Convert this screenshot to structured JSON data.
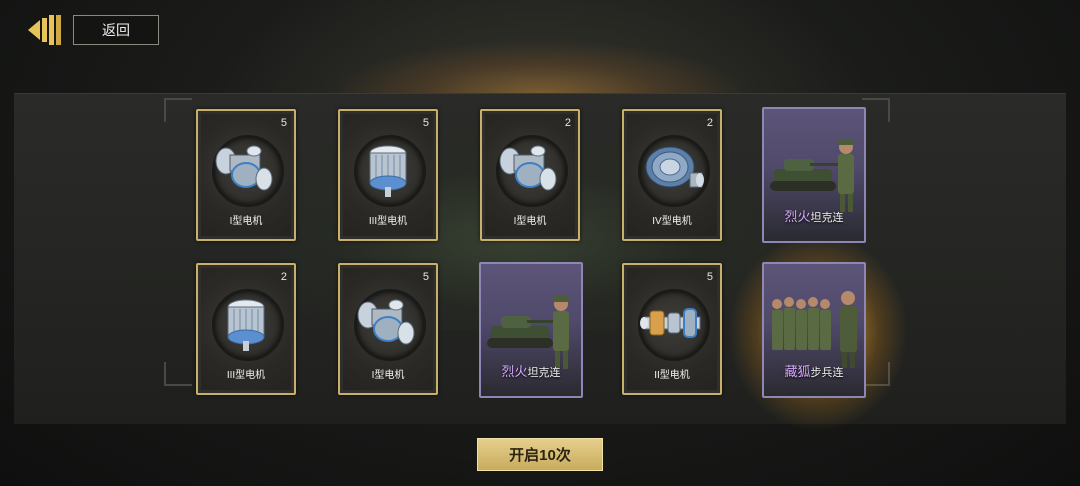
{
  "header": {
    "back_label": "返回"
  },
  "rewards": [
    {
      "name": "I型电机",
      "count": "5",
      "icon": "motor-part-icon"
    },
    {
      "name": "III型电机",
      "count": "5",
      "icon": "motor-cylinder-icon"
    },
    {
      "name": "I型电机",
      "count": "2",
      "icon": "motor-part-icon"
    },
    {
      "name": "IV型电机",
      "count": "2",
      "icon": "gear-motor-icon"
    },
    {
      "name_highlight": "烈火",
      "name_suffix": "坦克连",
      "icon": "tank-unit-icon"
    },
    {
      "name": "III型电机",
      "count": "2",
      "icon": "motor-cylinder-icon"
    },
    {
      "name": "I型电机",
      "count": "5",
      "icon": "motor-part-icon"
    },
    {
      "name_highlight": "烈火",
      "name_suffix": "坦克连",
      "icon": "tank-unit-icon"
    },
    {
      "name": "II型电机",
      "count": "5",
      "icon": "motor-shaft-icon"
    },
    {
      "name_highlight": "藏狐",
      "name_suffix": "步兵连",
      "icon": "infantry-unit-icon"
    }
  ],
  "footer": {
    "open_label": "开启10次"
  },
  "colors": {
    "card_border": "#c9b06a",
    "unit_border": "#8e86b4",
    "highlight": "#d7a9ff",
    "button": "#d8bd74"
  }
}
